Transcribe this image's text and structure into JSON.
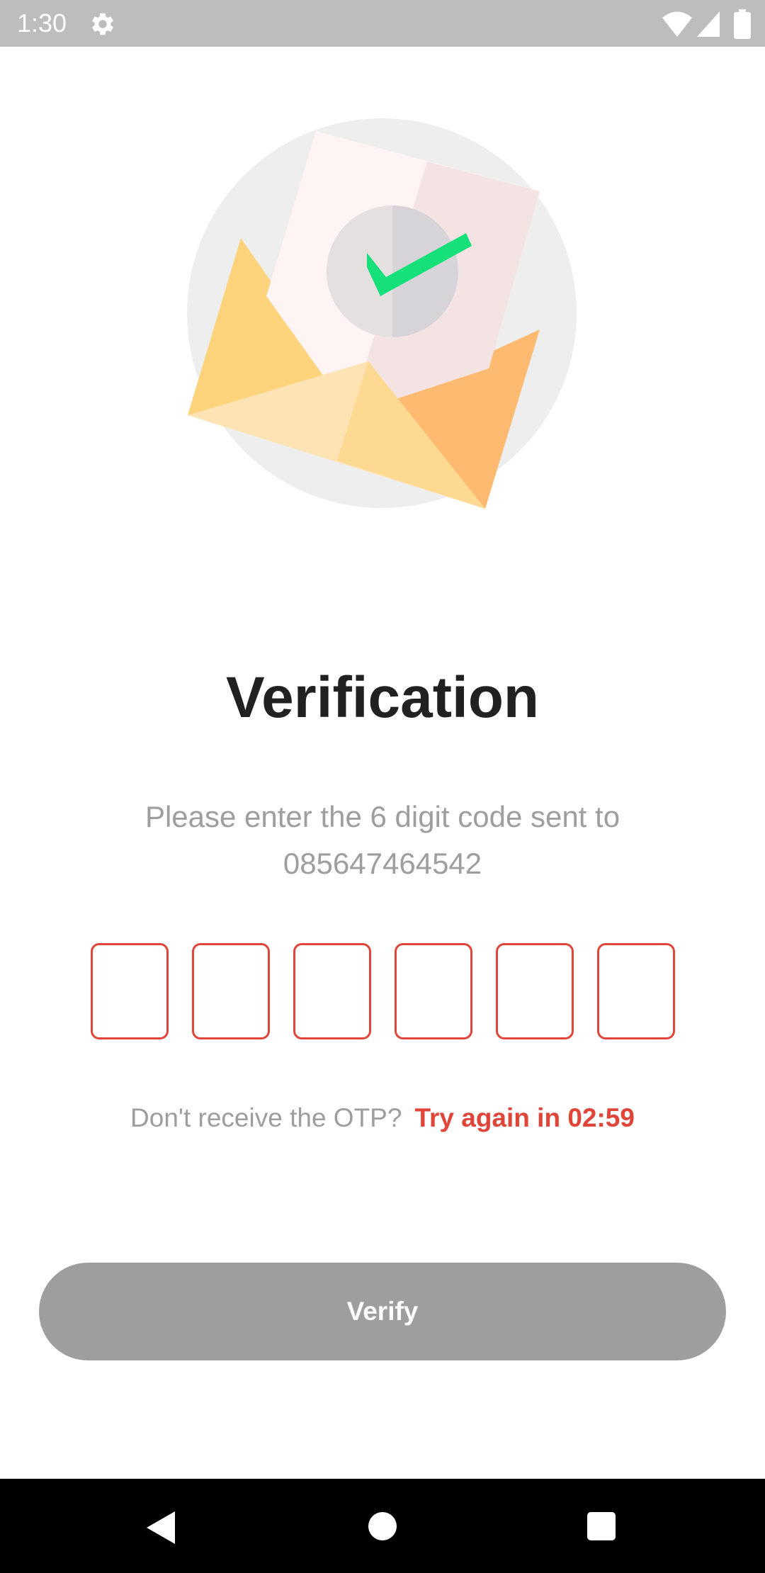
{
  "status_bar": {
    "time": "1:30"
  },
  "screen": {
    "title": "Verification",
    "subtitle_line1": "Please enter the 6 digit code sent to",
    "phone_number": "085647464542",
    "otp": {
      "length": 6,
      "digits": [
        "",
        "",
        "",
        "",
        "",
        ""
      ]
    },
    "resend_prompt": "Don't receive the OTP?",
    "resend_timer": "Try again in 02:59",
    "verify_label": "Verify"
  },
  "colors": {
    "accent": "#e0453a",
    "button_disabled": "#9e9e9e",
    "title": "#212121",
    "muted_text": "#9e9e9e",
    "check": "#16e07a"
  },
  "icons": {
    "status": [
      "gear-icon",
      "wifi-icon",
      "signal-icon",
      "battery-icon"
    ],
    "navigation": [
      "back-icon",
      "home-icon",
      "recents-icon"
    ],
    "illustration": "envelope-check-illustration"
  }
}
